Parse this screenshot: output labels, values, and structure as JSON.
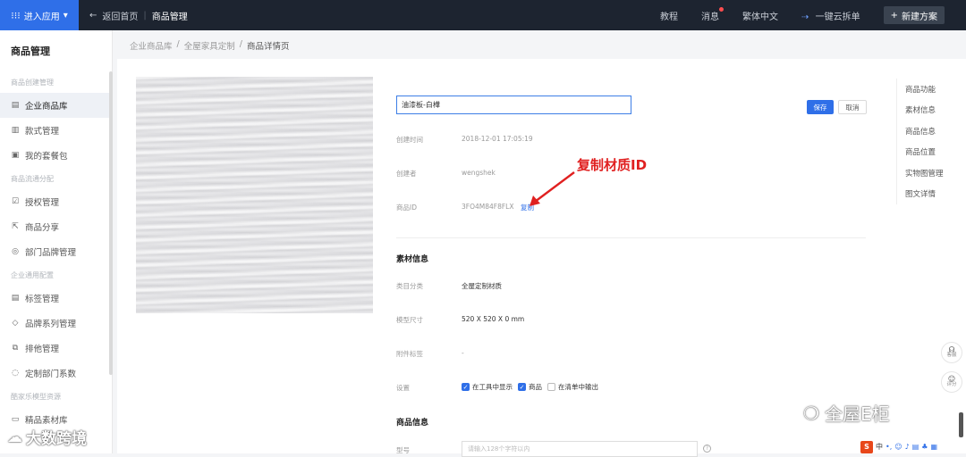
{
  "topbar": {
    "enter_app": "进入应用",
    "back_label": "返回首页",
    "separator": "|",
    "current": "商品管理",
    "tutorial": "教程",
    "messages": "消息",
    "language": "繁体中文",
    "split_order": "一键云拆单",
    "new_scheme": "新建方案"
  },
  "sidebar": {
    "title": "商品管理",
    "groups": [
      {
        "label": "商品创建管理",
        "items": [
          {
            "label": "企业商品库",
            "icon": "list-icon",
            "active": true
          },
          {
            "label": "款式管理",
            "icon": "layout-icon"
          },
          {
            "label": "我的套餐包",
            "icon": "package-icon"
          }
        ]
      },
      {
        "label": "商品流通分配",
        "items": [
          {
            "label": "授权管理",
            "icon": "authorize-icon"
          },
          {
            "label": "商品分享",
            "icon": "share-icon"
          },
          {
            "label": "部门品牌管理",
            "icon": "brand-icon"
          }
        ]
      },
      {
        "label": "企业通用配置",
        "items": [
          {
            "label": "标签管理",
            "icon": "tag-icon"
          },
          {
            "label": "品牌系列管理",
            "icon": "series-icon"
          },
          {
            "label": "排他管理",
            "icon": "exclusive-icon"
          },
          {
            "label": "定制部门系数",
            "icon": "coefficient-icon"
          }
        ]
      },
      {
        "label": "酷家乐模型资源",
        "items": [
          {
            "label": "精品素材库",
            "icon": "material-icon"
          }
        ]
      }
    ]
  },
  "breadcrumb": [
    "企业商品库",
    "全屋家具定制",
    "商品详情页"
  ],
  "product": {
    "name": "油漆板-白樺",
    "save": "保存",
    "cancel": "取消",
    "fields": {
      "created_time_label": "创建时间",
      "created_time": "2018-12-01 17:05:19",
      "creator_label": "创建者",
      "creator": "wengshek",
      "product_id_label": "商品ID",
      "product_id": "3FO4M84F8FLX",
      "copy": "复制"
    }
  },
  "annotation": "复制材质ID",
  "material": {
    "title": "素材信息",
    "category_label": "类目分类",
    "category": "全屋定制材质",
    "size_label": "模型尺寸",
    "size": "520 X 520 X 0 mm",
    "extra_label": "附件标签",
    "extra": "-",
    "settings_label": "设置",
    "settings": [
      {
        "label": "在工具中显示",
        "checked": true
      },
      {
        "label": "商品",
        "checked": true
      },
      {
        "label": "在清单中输出",
        "checked": false
      }
    ]
  },
  "product_info": {
    "title": "商品信息",
    "model_label": "型号",
    "model_placeholder": "请输入128个字符以内"
  },
  "anchor_nav": [
    "商品功能",
    "素材信息",
    "商品信息",
    "商品位置",
    "实物图管理",
    "图文详情"
  ],
  "float": {
    "service": "客服",
    "feedback": "评分"
  },
  "watermarks": {
    "right": "全屋E柜",
    "left": "大数跨境"
  },
  "ime": "中"
}
